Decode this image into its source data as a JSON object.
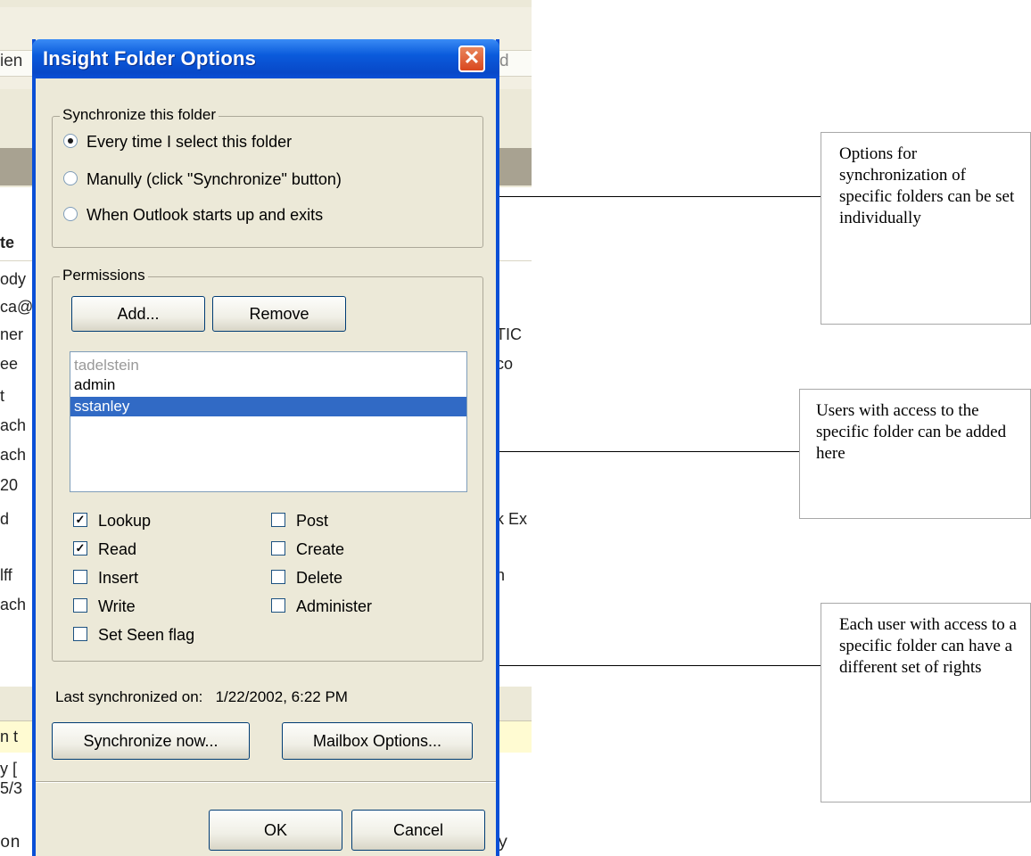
{
  "background": {
    "top_left_fragment": "ien",
    "top_right_fragment": "d",
    "rows_left": [
      "te",
      "ody",
      "ca@",
      "ner",
      "ee",
      "t",
      "ach",
      "ach",
      "20",
      "d",
      "lff",
      "ach"
    ],
    "rows_right": [
      "TIC",
      "co",
      "k Ex",
      "h"
    ],
    "lower_left": [
      "n t",
      "y [",
      "5/3",
      "on"
    ],
    "lower_right": "y"
  },
  "dialog": {
    "title": "Insight Folder Options",
    "close_glyph": "✕",
    "sync_group": {
      "legend": "Synchronize this folder",
      "options": [
        {
          "label": "Every time I select this folder",
          "selected": true
        },
        {
          "label": "Manully (click \"Synchronize\" button)",
          "selected": false
        },
        {
          "label": "When Outlook starts up and exits",
          "selected": false
        }
      ]
    },
    "permissions": {
      "legend": "Permissions",
      "add_label": "Add...",
      "remove_label": "Remove",
      "users": [
        {
          "name": "tadelstein",
          "selected": false
        },
        {
          "name": "admin",
          "selected": false
        },
        {
          "name": "sstanley",
          "selected": true
        }
      ],
      "rights_left": [
        {
          "label": "Lookup",
          "checked": true
        },
        {
          "label": "Read",
          "checked": true
        },
        {
          "label": "Insert",
          "checked": false
        },
        {
          "label": "Write",
          "checked": false
        },
        {
          "label": "Set Seen flag",
          "checked": false
        }
      ],
      "rights_right": [
        {
          "label": "Post",
          "checked": false
        },
        {
          "label": "Create",
          "checked": false
        },
        {
          "label": "Delete",
          "checked": false
        },
        {
          "label": "Administer",
          "checked": false
        }
      ]
    },
    "last_sync_label": "Last synchronized on:",
    "last_sync_value": "1/22/2002, 6:22 PM",
    "sync_now_label": "Synchronize now...",
    "mailbox_options_label": "Mailbox Options...",
    "ok_label": "OK",
    "cancel_label": "Cancel",
    "check_glyph": "✓"
  },
  "annotations": [
    "Options for synchronization of specific folders can be set individually",
    "Users with access to the specific folder can be added here",
    "Each user with access to a specific folder can have a different set of rights"
  ]
}
